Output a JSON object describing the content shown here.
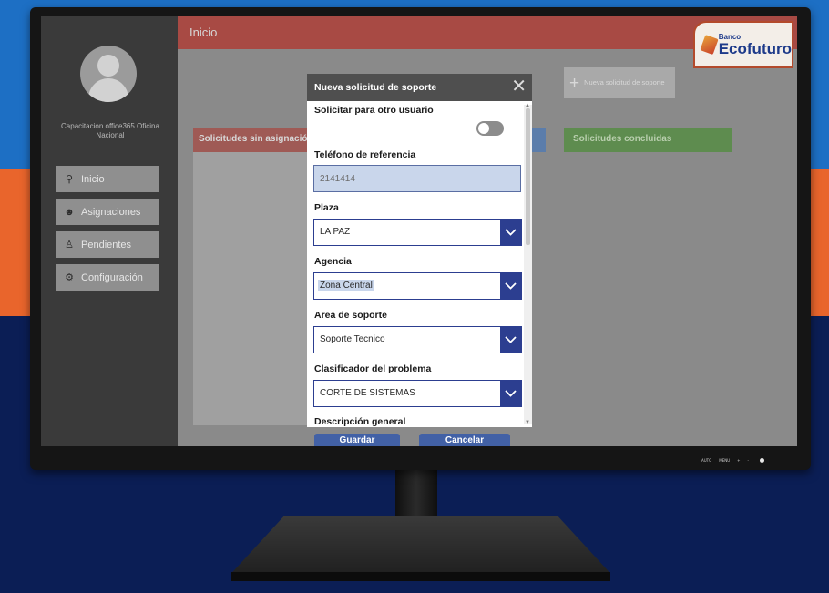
{
  "app": {
    "user_name": "Capacitacion office365 Oficina Nacional",
    "page_title": "Inicio",
    "logo": {
      "line1": "Banco",
      "line2": "Ecofuturo"
    }
  },
  "sidebar": {
    "items": [
      {
        "label": "Inicio",
        "icon": "hierarchy-icon"
      },
      {
        "label": "Asignaciones",
        "icon": "people-icon"
      },
      {
        "label": "Pendientes",
        "icon": "person-icon"
      },
      {
        "label": "Configuración",
        "icon": "gear-icon"
      }
    ]
  },
  "actions": {
    "new_request": "Nueva solicitud de soporte"
  },
  "columns": {
    "pending": "Solicitudes sin asignación",
    "done": "Solicitudes concluidas"
  },
  "modal": {
    "title": "Nueva solicitud de soporte",
    "other_user_label": "Solicitar para otro usuario",
    "other_user_toggle": false,
    "phone_label": "Teléfono de referencia",
    "phone_value": "2141414",
    "plaza_label": "Plaza",
    "plaza_value": "LA PAZ",
    "agencia_label": "Agencia",
    "agencia_value": "Zona Central",
    "area_label": "Area de soporte",
    "area_value": "Soporte Tecnico",
    "clasif_label": "Clasificador del problema",
    "clasif_value": "CORTE DE SISTEMAS",
    "desc_label": "Descripción general",
    "save_label": "Guardar",
    "cancel_label": "Cancelar"
  },
  "monitor": {
    "controls": [
      "AUTO",
      "MENU",
      "+",
      "-"
    ]
  },
  "colors": {
    "accent": "#2c3e90",
    "header_red": "#a84a44",
    "orange_band": "#e9652c",
    "blue_band": "#1d6fc4",
    "navy_band": "#0b1e55"
  }
}
